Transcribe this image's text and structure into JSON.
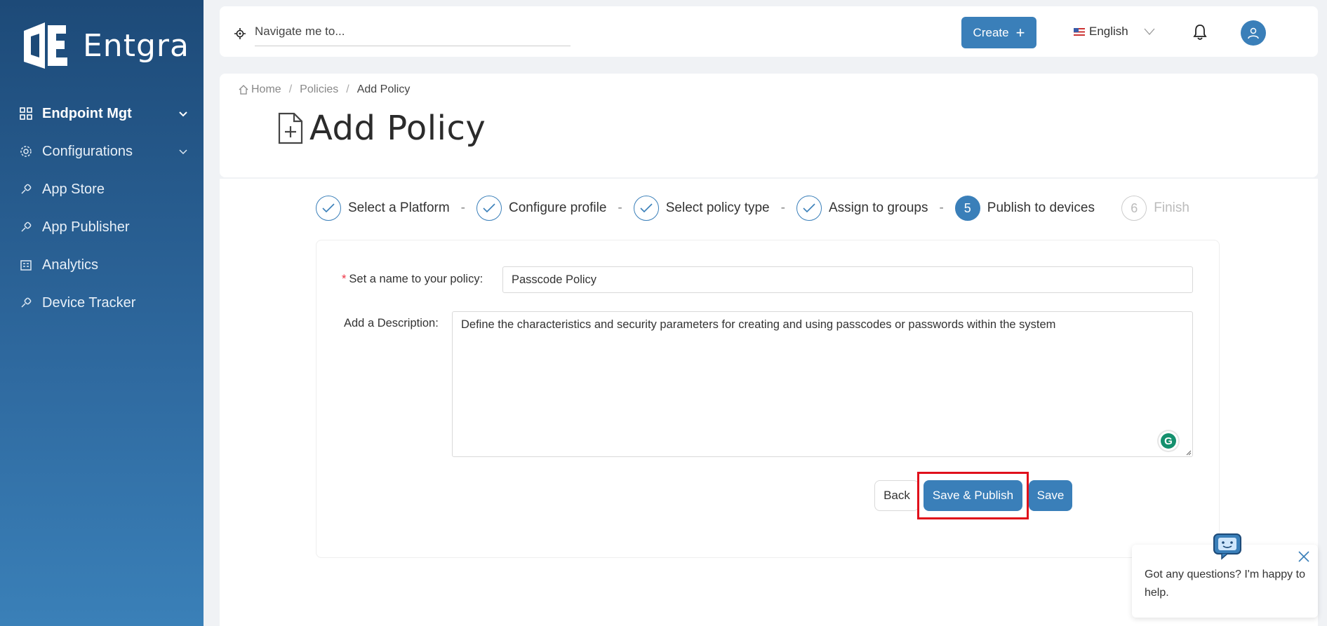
{
  "app": {
    "logo_text": "Entgra"
  },
  "sidebar": {
    "items": [
      {
        "label": "Endpoint Mgt",
        "icon": "grid-icon"
      },
      {
        "label": "Configurations",
        "icon": "gear-icon"
      },
      {
        "label": "App Store",
        "icon": "link-icon"
      },
      {
        "label": "App Publisher",
        "icon": "link-icon"
      },
      {
        "label": "Analytics",
        "icon": "building-icon"
      },
      {
        "label": "Device Tracker",
        "icon": "link-icon"
      }
    ]
  },
  "topbar": {
    "search_placeholder": "Navigate me to...",
    "create_label": "Create",
    "language": "English"
  },
  "breadcrumb": {
    "home": "Home",
    "policies": "Policies",
    "current": "Add Policy"
  },
  "page": {
    "title": "Add Policy"
  },
  "stepper": {
    "steps": [
      {
        "label": "Select a Platform",
        "state": "done"
      },
      {
        "label": "Configure profile",
        "state": "done"
      },
      {
        "label": "Select policy type",
        "state": "done"
      },
      {
        "label": "Assign to groups",
        "state": "done"
      },
      {
        "label": "Publish to devices",
        "number": "5",
        "state": "active"
      },
      {
        "label": "Finish",
        "number": "6",
        "state": "pending"
      }
    ],
    "separator": "-"
  },
  "form": {
    "name_label": "Set a name to your policy",
    "name_value": "Passcode Policy",
    "desc_label": "Add a Description",
    "desc_value": "Define the characteristics and security parameters for creating and using passcodes or passwords within the system",
    "back_label": "Back",
    "save_publish_label": "Save & Publish",
    "save_label": "Save"
  },
  "chat": {
    "message": "Got any questions? I'm happy to help."
  },
  "colors": {
    "primary": "#3a7fb9",
    "sidebar_top": "#1d4a78",
    "highlight": "#e0101b"
  }
}
